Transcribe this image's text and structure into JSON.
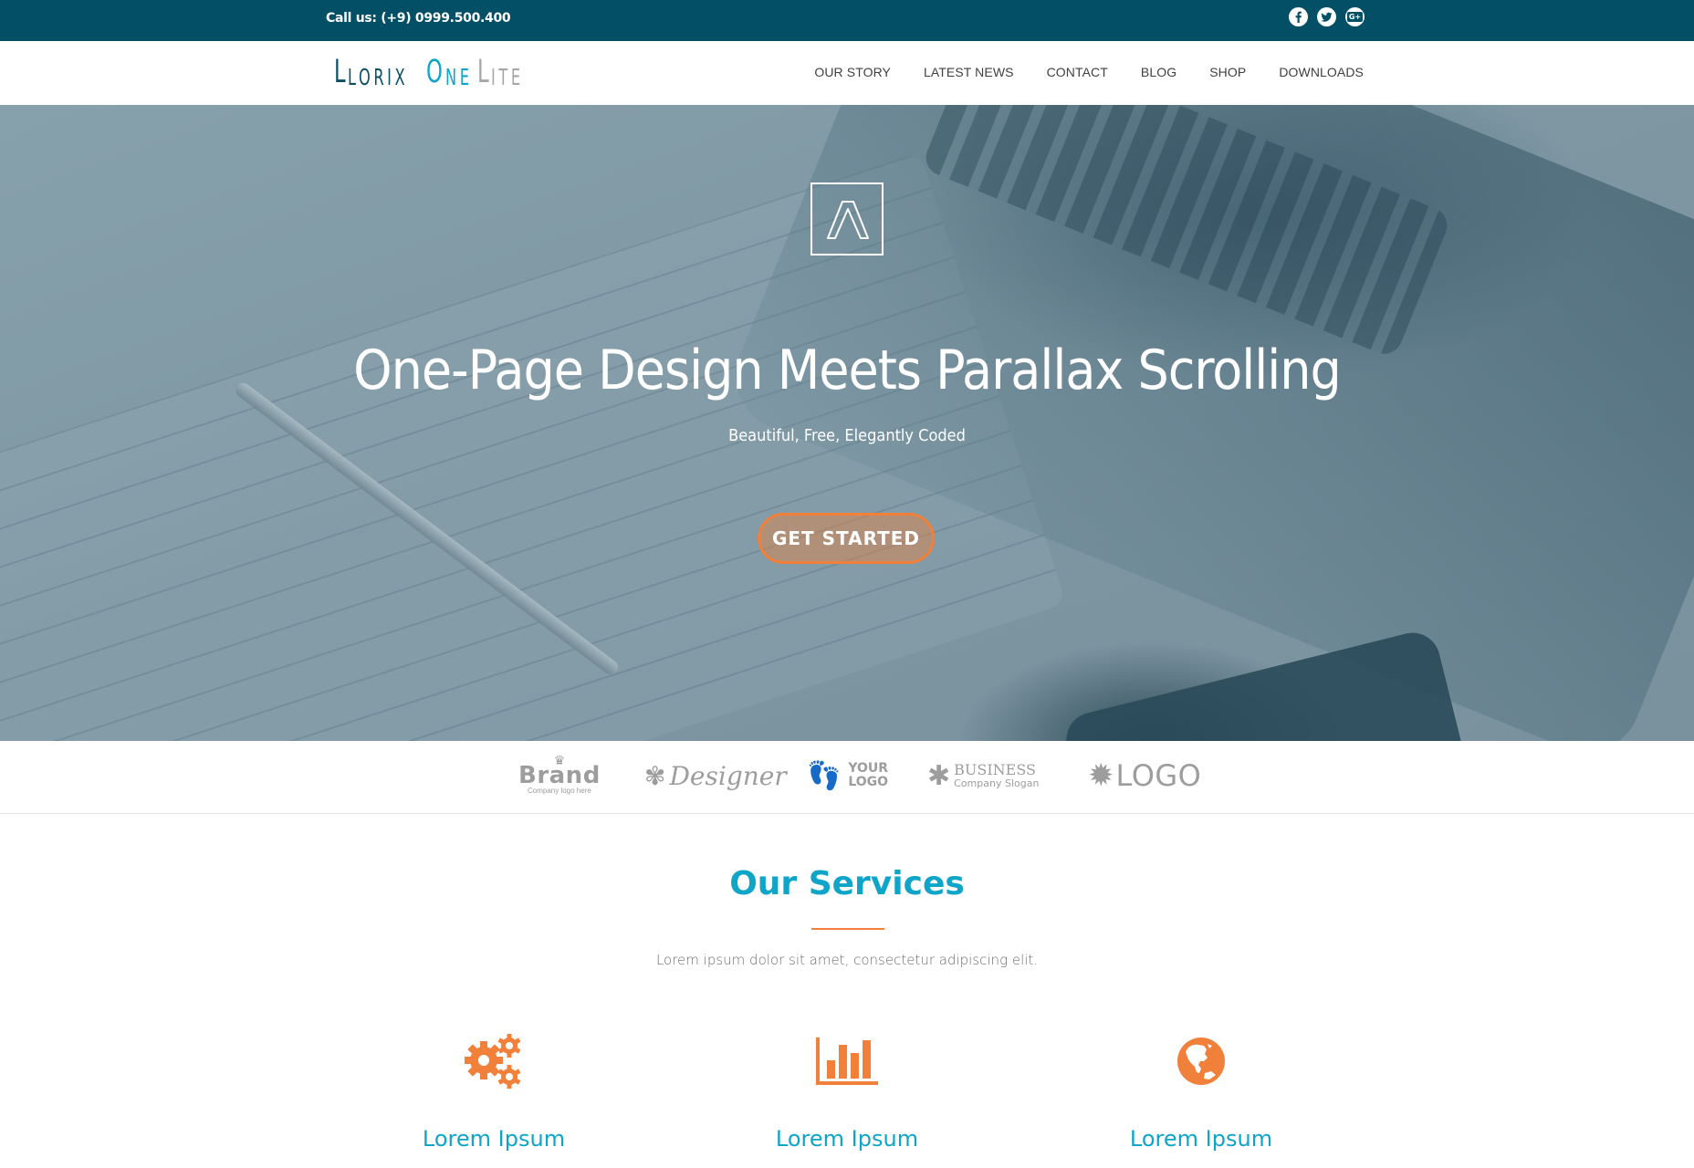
{
  "topbar": {
    "call_text": "Call us: (+9) 0999.500.400",
    "socials": [
      {
        "name": "facebook",
        "glyph": "f"
      },
      {
        "name": "twitter",
        "glyph": "t"
      },
      {
        "name": "google-plus",
        "glyph": "G+"
      }
    ]
  },
  "header": {
    "logo": {
      "part1": "Llorix",
      "part2": "One",
      "part3": "Lite"
    },
    "nav": [
      "OUR STORY",
      "LATEST NEWS",
      "CONTACT",
      "BLOG",
      "SHOP",
      "DOWNLOADS"
    ]
  },
  "hero": {
    "title": "One-Page Design Meets Parallax Scrolling",
    "subtitle": "Beautiful, Free, Elegantly Coded",
    "cta_label": "GET STARTED"
  },
  "clients": {
    "brand": {
      "name": "Brand",
      "tagline": "Company logo here"
    },
    "designer": {
      "name": "Designer"
    },
    "your_logo": {
      "line1": "YOUR",
      "line2": "LOGO"
    },
    "business": {
      "name": "BUSINESS",
      "slogan": "Company Slogan"
    },
    "logo": {
      "name": "LOGO"
    }
  },
  "services": {
    "title": "Our Services",
    "subtitle": "Lorem ipsum dolor sit amet, consectetur adipiscing elit.",
    "items": [
      {
        "icon": "gears-icon",
        "label": "Lorem Ipsum"
      },
      {
        "icon": "bar-chart-icon",
        "label": "Lorem Ipsum"
      },
      {
        "icon": "globe-icon",
        "label": "Lorem Ipsum"
      }
    ]
  },
  "colors": {
    "topbar": "#034f66",
    "accent_blue": "#0fa5c8",
    "accent_orange": "#f0803a",
    "logo_dark": "#0b4f66",
    "logo_grey": "#a6a6a6"
  }
}
